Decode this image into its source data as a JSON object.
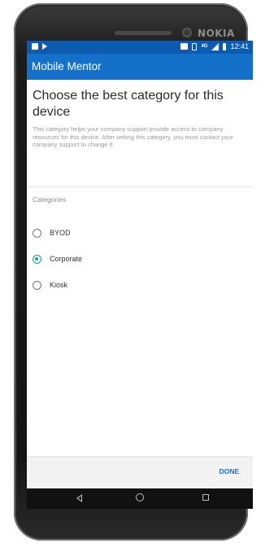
{
  "device": {
    "brand": "NOKIA"
  },
  "status_bar": {
    "time": "12:41",
    "network": "4G",
    "left_icons": [
      "notification-icon",
      "play-store-icon"
    ],
    "right_icons": [
      "briefcase-icon",
      "vibrate-icon",
      "network-4g-icon",
      "signal-icon",
      "battery-icon"
    ]
  },
  "app_bar": {
    "title": "Mobile Mentor"
  },
  "page": {
    "heading": "Choose the best category for this device",
    "description": "This category helps your company support provide access to company resources for this device. After setting this category, you must contact your company support to change it.",
    "categories_label": "Categories"
  },
  "categories": {
    "options": [
      {
        "label": "BYOD",
        "selected": false
      },
      {
        "label": "Corporate",
        "selected": true
      },
      {
        "label": "Kiosk",
        "selected": false
      }
    ]
  },
  "footer": {
    "done_label": "DONE"
  },
  "nav_bar": {
    "icons": [
      "back-icon",
      "home-icon",
      "recents-icon"
    ]
  },
  "colors": {
    "status_bar": "#0d5bb1",
    "app_bar": "#1470c8",
    "accent": "#1d9a8a",
    "done_text": "#1470c8"
  }
}
